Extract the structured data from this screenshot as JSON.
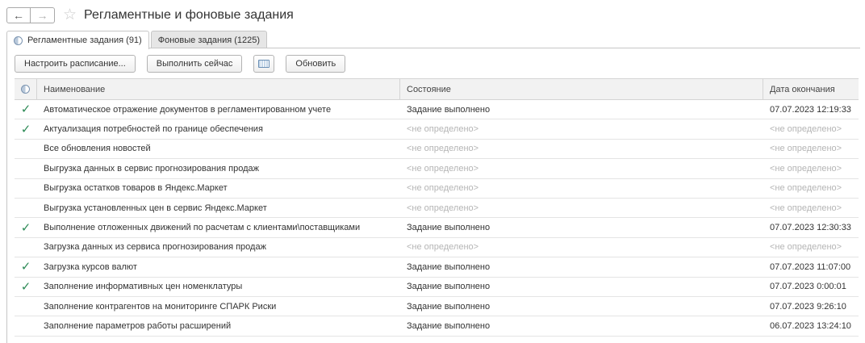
{
  "window": {
    "title": "Регламентные и фоновые задания",
    "back_symbol": "←",
    "forward_symbol": "→",
    "favorite_symbol": "☆"
  },
  "tabs": [
    {
      "label": "Регламентные задания (91)",
      "active": true
    },
    {
      "label": "Фоновые задания (1225)",
      "active": false
    }
  ],
  "toolbar": {
    "schedule_label": "Настроить расписание...",
    "run_now_label": "Выполнить сейчас",
    "refresh_label": "Обновить"
  },
  "table": {
    "columns": {
      "name": "Наименование",
      "state": "Состояние",
      "end_date": "Дата окончания"
    },
    "rows": [
      {
        "check": "✓",
        "name": "Автоматическое отражение документов в регламентированном учете",
        "state": "Задание выполнено",
        "date": "07.07.2023 12:19:33"
      },
      {
        "check": "✓",
        "name": "Актуализация потребностей по границе обеспечения",
        "state": "<не определено>",
        "date": "<не определено>"
      },
      {
        "check": "",
        "name": "Все обновления новостей",
        "state": "<не определено>",
        "date": "<не определено>"
      },
      {
        "check": "",
        "name": "Выгрузка данных в сервис прогнозирования продаж",
        "state": "<не определено>",
        "date": "<не определено>"
      },
      {
        "check": "",
        "name": "Выгрузка остатков товаров в  Яндекс.Маркет",
        "state": "<не определено>",
        "date": "<не определено>"
      },
      {
        "check": "",
        "name": "Выгрузка установленных цен в сервис Яндекс.Маркет",
        "state": "<не определено>",
        "date": "<не определено>"
      },
      {
        "check": "✓",
        "name": "Выполнение отложенных движений по расчетам с клиентами\\поставщиками",
        "state": "Задание выполнено",
        "date": "07.07.2023 12:30:33"
      },
      {
        "check": "",
        "name": "Загрузка данных из сервиса прогнозирования продаж",
        "state": "<не определено>",
        "date": "<не определено>"
      },
      {
        "check": "✓",
        "name": "Загрузка курсов валют",
        "state": "Задание выполнено",
        "date": "07.07.2023 11:07:00"
      },
      {
        "check": "✓",
        "name": "Заполнение информативных цен номенклатуры",
        "state": "Задание выполнено",
        "date": "07.07.2023 0:00:01"
      },
      {
        "check": "",
        "name": "Заполнение контрагентов на мониторинге СПАРК Риски",
        "state": "Задание выполнено",
        "date": "07.07.2023 9:26:10"
      },
      {
        "check": "",
        "name": "Заполнение параметров работы расширений",
        "state": "Задание выполнено",
        "date": "06.07.2023 13:24:10"
      }
    ]
  },
  "colors": {
    "check": "#2e8b57",
    "undefined_text": "#b5b5b5",
    "header_bg": "#f2f2f2"
  }
}
